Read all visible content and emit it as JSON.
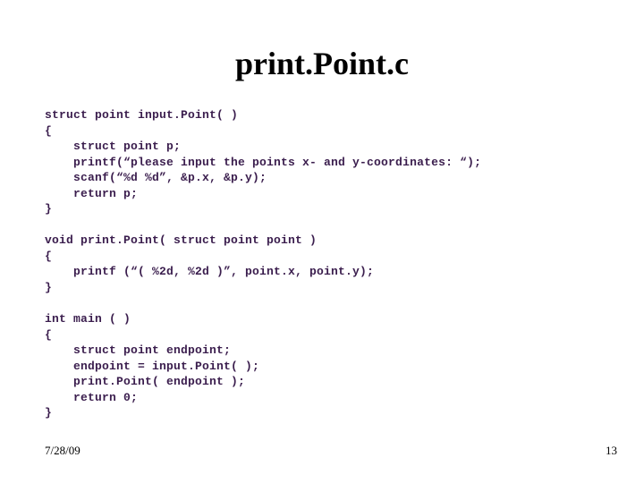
{
  "title": "print.Point.c",
  "code": "struct point input.Point( )\n{\n    struct point p;\n    printf(“please input the points x- and y-coordinates: “);\n    scanf(“%d %d”, &p.x, &p.y);\n    return p;\n}\n\nvoid print.Point( struct point point )\n{\n    printf (“( %2d, %2d )”, point.x, point.y);\n}\n\nint main ( )\n{\n    struct point endpoint;\n    endpoint = input.Point( );\n    print.Point( endpoint );\n    return 0;\n}",
  "footer": {
    "date": "7/28/09",
    "page": "13"
  }
}
